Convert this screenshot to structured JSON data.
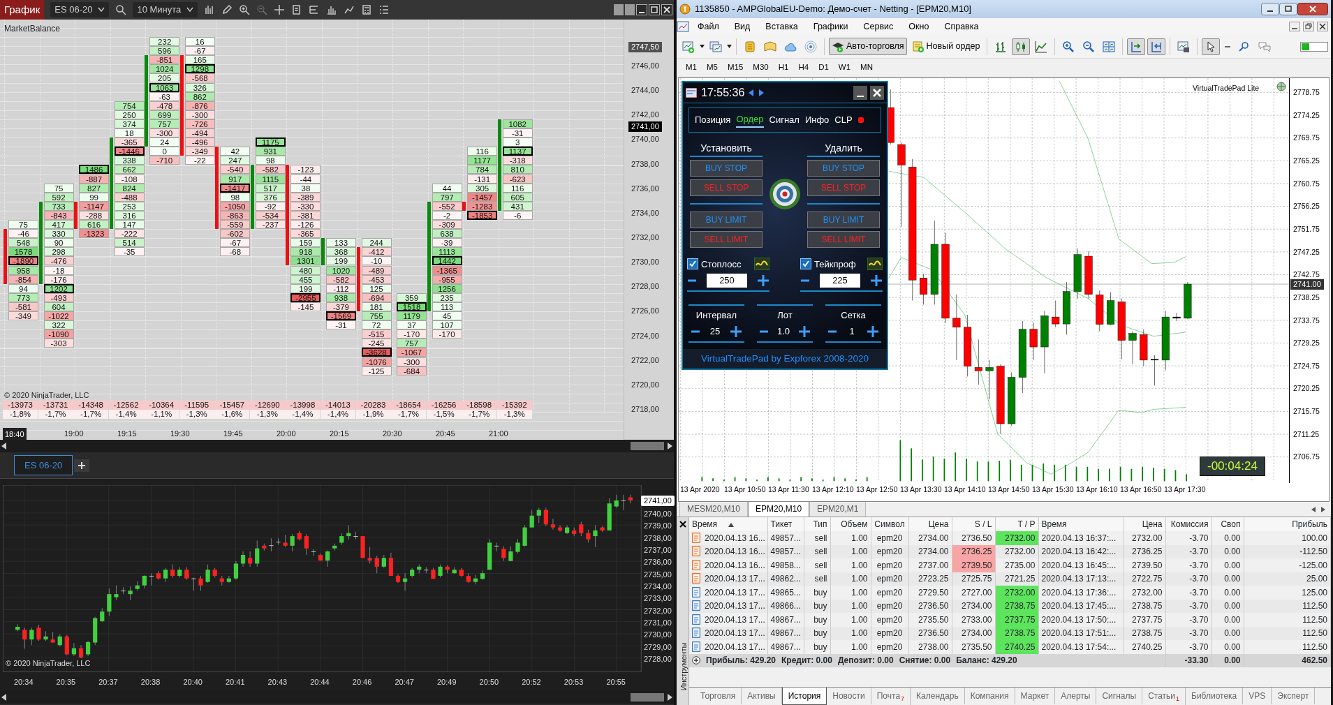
{
  "ninja": {
    "toolbar": {
      "title": "График",
      "instrument": "ES 06-20",
      "interval": "10 Минута"
    },
    "footprint": {
      "indicator": "MarketBalance",
      "copyright": "© 2020 NinjaTrader, LLC",
      "columns": [
        {
          "kind": "down",
          "total": "-13973",
          "percent": "-1,8%",
          "cells": [
            {
              "value": "75",
              "boxed": false
            },
            {
              "value": "-46",
              "boxed": false
            },
            {
              "value": "548",
              "boxed": false
            },
            {
              "value": "1578",
              "boxed": false
            },
            {
              "value": "-1890",
              "boxed": true
            },
            {
              "value": "958",
              "boxed": false
            },
            {
              "value": "-854",
              "boxed": false
            },
            {
              "value": "94",
              "boxed": false
            },
            {
              "value": "773",
              "boxed": false
            },
            {
              "value": "-581",
              "boxed": false
            },
            {
              "value": "-349",
              "boxed": false
            }
          ]
        },
        {
          "kind": "up",
          "total": "-13731",
          "percent": "-1,7%",
          "cells": [
            {
              "value": "75",
              "boxed": false
            },
            {
              "value": "592",
              "boxed": false
            },
            {
              "value": "733",
              "boxed": false
            },
            {
              "value": "-843",
              "boxed": false
            },
            {
              "value": "417",
              "boxed": false
            },
            {
              "value": "330",
              "boxed": false
            },
            {
              "value": "90",
              "boxed": false
            },
            {
              "value": "298",
              "boxed": false
            },
            {
              "value": "-476",
              "boxed": false
            },
            {
              "value": "-18",
              "boxed": false
            },
            {
              "value": "-176",
              "boxed": false
            },
            {
              "value": "1202",
              "boxed": true
            },
            {
              "value": "-493",
              "boxed": false
            },
            {
              "value": "604",
              "boxed": false
            },
            {
              "value": "-1022",
              "boxed": false
            },
            {
              "value": "322",
              "boxed": false
            },
            {
              "value": "-1090",
              "boxed": false
            },
            {
              "value": "-303",
              "boxed": false
            }
          ]
        },
        {
          "kind": "down",
          "total": "-14348",
          "percent": "-1,7%",
          "cells": [
            {
              "value": "1486",
              "boxed": true
            },
            {
              "value": "-887",
              "boxed": false
            },
            {
              "value": "827",
              "boxed": false
            },
            {
              "value": "99",
              "boxed": false
            },
            {
              "value": "-1147",
              "boxed": false
            },
            {
              "value": "-288",
              "boxed": false
            },
            {
              "value": "616",
              "boxed": false
            },
            {
              "value": "-1323",
              "boxed": false
            }
          ]
        },
        {
          "kind": "up",
          "total": "-12562",
          "percent": "-1,4%",
          "cells": [
            {
              "value": "754",
              "boxed": false
            },
            {
              "value": "250",
              "boxed": false
            },
            {
              "value": "374",
              "boxed": false
            },
            {
              "value": "18",
              "boxed": false
            },
            {
              "value": "-365",
              "boxed": false
            },
            {
              "value": "-1446",
              "boxed": true
            },
            {
              "value": "338",
              "boxed": false
            },
            {
              "value": "662",
              "boxed": false
            },
            {
              "value": "-108",
              "boxed": false
            },
            {
              "value": "824",
              "boxed": false
            },
            {
              "value": "-488",
              "boxed": false
            },
            {
              "value": "253",
              "boxed": false
            },
            {
              "value": "316",
              "boxed": false
            },
            {
              "value": "147",
              "boxed": false
            },
            {
              "value": "-222",
              "boxed": false
            },
            {
              "value": "514",
              "boxed": false
            },
            {
              "value": "-35",
              "boxed": false
            }
          ]
        },
        {
          "kind": "up",
          "total": "-10364",
          "percent": "-1,1%",
          "cells": [
            {
              "value": "232",
              "boxed": false
            },
            {
              "value": "596",
              "boxed": false
            },
            {
              "value": "-851",
              "boxed": false
            },
            {
              "value": "1024",
              "boxed": false
            },
            {
              "value": "205",
              "boxed": false
            },
            {
              "value": "1063",
              "boxed": true
            },
            {
              "value": "-63",
              "boxed": false
            },
            {
              "value": "-478",
              "boxed": false
            },
            {
              "value": "699",
              "boxed": false
            },
            {
              "value": "757",
              "boxed": false
            },
            {
              "value": "-300",
              "boxed": false
            },
            {
              "value": "24",
              "boxed": false
            },
            {
              "value": "0",
              "boxed": false
            },
            {
              "value": "-710",
              "boxed": false
            }
          ]
        },
        {
          "kind": "down",
          "total": "-11595",
          "percent": "-1,3%",
          "cells": [
            {
              "value": "16",
              "boxed": false
            },
            {
              "value": "-67",
              "boxed": false
            },
            {
              "value": "165",
              "boxed": false
            },
            {
              "value": "1298",
              "boxed": true
            },
            {
              "value": "-568",
              "boxed": false
            },
            {
              "value": "326",
              "boxed": false
            },
            {
              "value": "862",
              "boxed": false
            },
            {
              "value": "-876",
              "boxed": false
            },
            {
              "value": "-300",
              "boxed": false
            },
            {
              "value": "-726",
              "boxed": false
            },
            {
              "value": "-494",
              "boxed": false
            },
            {
              "value": "-496",
              "boxed": false
            },
            {
              "value": "-349",
              "boxed": false
            },
            {
              "value": "-22",
              "boxed": false
            }
          ]
        },
        {
          "kind": "down",
          "total": "-15457",
          "percent": "-1,6%",
          "cells": [
            {
              "value": "42",
              "boxed": false
            },
            {
              "value": "247",
              "boxed": false
            },
            {
              "value": "-540",
              "boxed": false
            },
            {
              "value": "917",
              "boxed": false
            },
            {
              "value": "-1417",
              "boxed": true
            },
            {
              "value": "98",
              "boxed": false
            },
            {
              "value": "-1050",
              "boxed": false
            },
            {
              "value": "-863",
              "boxed": false
            },
            {
              "value": "-559",
              "boxed": false
            },
            {
              "value": "-602",
              "boxed": false
            },
            {
              "value": "-67",
              "boxed": false
            },
            {
              "value": "-68",
              "boxed": false
            }
          ]
        },
        {
          "kind": "up",
          "total": "-12690",
          "percent": "-1,3%",
          "cells": [
            {
              "value": "1175",
              "boxed": true
            },
            {
              "value": "931",
              "boxed": false
            },
            {
              "value": "98",
              "boxed": false
            },
            {
              "value": "-582",
              "boxed": false
            },
            {
              "value": "1115",
              "boxed": false
            },
            {
              "value": "517",
              "boxed": false
            },
            {
              "value": "376",
              "boxed": false
            },
            {
              "value": "-92",
              "boxed": false
            },
            {
              "value": "-534",
              "boxed": false
            },
            {
              "value": "-237",
              "boxed": false
            }
          ]
        },
        {
          "kind": "down",
          "total": "-13998",
          "percent": "-1,4%",
          "cells": [
            {
              "value": "-123",
              "boxed": false
            },
            {
              "value": "-44",
              "boxed": false
            },
            {
              "value": "38",
              "boxed": false
            },
            {
              "value": "-389",
              "boxed": false
            },
            {
              "value": "-330",
              "boxed": false
            },
            {
              "value": "-381",
              "boxed": false
            },
            {
              "value": "-126",
              "boxed": false
            },
            {
              "value": "-365",
              "boxed": false
            },
            {
              "value": "159",
              "boxed": false
            },
            {
              "value": "918",
              "boxed": false
            },
            {
              "value": "1301",
              "boxed": false
            },
            {
              "value": "480",
              "boxed": false
            },
            {
              "value": "455",
              "boxed": false
            },
            {
              "value": "199",
              "boxed": false
            },
            {
              "value": "-2955",
              "boxed": true
            },
            {
              "value": "-145",
              "boxed": false
            }
          ]
        },
        {
          "kind": "up",
          "total": "-14013",
          "percent": "-1,4%",
          "cells": [
            {
              "value": "133",
              "boxed": false
            },
            {
              "value": "368",
              "boxed": false
            },
            {
              "value": "199",
              "boxed": false
            },
            {
              "value": "1020",
              "boxed": false
            },
            {
              "value": "-582",
              "boxed": false
            },
            {
              "value": "-112",
              "boxed": false
            },
            {
              "value": "938",
              "boxed": false
            },
            {
              "value": "-379",
              "boxed": false
            },
            {
              "value": "-1569",
              "boxed": true
            },
            {
              "value": "-31",
              "boxed": false
            }
          ]
        },
        {
          "kind": "down",
          "total": "-20283",
          "percent": "-1,9%",
          "cells": [
            {
              "value": "244",
              "boxed": false
            },
            {
              "value": "-412",
              "boxed": false
            },
            {
              "value": "-10",
              "boxed": false
            },
            {
              "value": "-489",
              "boxed": false
            },
            {
              "value": "-453",
              "boxed": false
            },
            {
              "value": "125",
              "boxed": false
            },
            {
              "value": "-694",
              "boxed": false
            },
            {
              "value": "181",
              "boxed": false
            },
            {
              "value": "755",
              "boxed": false
            },
            {
              "value": "72",
              "boxed": false
            },
            {
              "value": "-515",
              "boxed": false
            },
            {
              "value": "-245",
              "boxed": false
            },
            {
              "value": "-3628",
              "boxed": true
            },
            {
              "value": "-1076",
              "boxed": false
            },
            {
              "value": "-125",
              "boxed": false
            }
          ]
        },
        {
          "kind": "flat",
          "total": "-18654",
          "percent": "-1,7%",
          "cells": [
            {
              "value": "359",
              "boxed": false
            },
            {
              "value": "1518",
              "boxed": true
            },
            {
              "value": "1179",
              "boxed": false
            },
            {
              "value": "37",
              "boxed": false
            },
            {
              "value": "-170",
              "boxed": false
            },
            {
              "value": "757",
              "boxed": false
            },
            {
              "value": "-1067",
              "boxed": false
            },
            {
              "value": "-300",
              "boxed": false
            },
            {
              "value": "-684",
              "boxed": false
            }
          ]
        },
        {
          "kind": "up",
          "total": "-16256",
          "percent": "-1,5%",
          "cells": [
            {
              "value": "44",
              "boxed": false
            },
            {
              "value": "797",
              "boxed": false
            },
            {
              "value": "-552",
              "boxed": false
            },
            {
              "value": "-2",
              "boxed": false
            },
            {
              "value": "-309",
              "boxed": false
            },
            {
              "value": "638",
              "boxed": false
            },
            {
              "value": "-39",
              "boxed": false
            },
            {
              "value": "1113",
              "boxed": false
            },
            {
              "value": "1442",
              "boxed": true
            },
            {
              "value": "-1365",
              "boxed": false
            },
            {
              "value": "-955",
              "boxed": false
            },
            {
              "value": "1256",
              "boxed": false
            },
            {
              "value": "235",
              "boxed": false
            },
            {
              "value": "113",
              "boxed": false
            },
            {
              "value": "45",
              "boxed": false
            },
            {
              "value": "107",
              "boxed": false
            },
            {
              "value": "-170",
              "boxed": false
            }
          ]
        },
        {
          "kind": "down",
          "total": "-18598",
          "percent": "-1,7%",
          "cells": [
            {
              "value": "116",
              "boxed": false
            },
            {
              "value": "1177",
              "boxed": false
            },
            {
              "value": "784",
              "boxed": false
            },
            {
              "value": "-131",
              "boxed": false
            },
            {
              "value": "305",
              "boxed": false
            },
            {
              "value": "-1457",
              "boxed": false
            },
            {
              "value": "-1283",
              "boxed": false
            },
            {
              "value": "-1853",
              "boxed": true
            }
          ]
        },
        {
          "kind": "up",
          "total": "-15392",
          "percent": "-1,3%",
          "cells": [
            {
              "value": "1082",
              "boxed": false
            },
            {
              "value": "-31",
              "boxed": false
            },
            {
              "value": "3",
              "boxed": false
            },
            {
              "value": "1137",
              "boxed": true
            },
            {
              "value": "-318",
              "boxed": false
            },
            {
              "value": "810",
              "boxed": false
            },
            {
              "value": "-623",
              "boxed": false
            },
            {
              "value": "116",
              "boxed": false
            },
            {
              "value": "605",
              "boxed": false
            },
            {
              "value": "431",
              "boxed": false
            },
            {
              "value": "-6",
              "boxed": false
            }
          ]
        }
      ],
      "price_labels": [
        "2746,00",
        "2744,00",
        "2742,00",
        "2740,00",
        "2738,00",
        "2736,00",
        "2734,00",
        "2732,00",
        "2730,00",
        "2728,00",
        "2726,00",
        "2724,00",
        "2722,00",
        "2720,00",
        "2718,00"
      ],
      "price_markers": [
        {
          "text": "2747,50",
          "kind": "ask"
        },
        {
          "text": "2741,00",
          "kind": "last"
        }
      ],
      "time_labels": [
        {
          "text": "18:40",
          "selected": true
        },
        {
          "text": "19:00",
          "selected": false
        },
        {
          "text": "19:15",
          "selected": false
        },
        {
          "text": "19:30",
          "selected": false
        },
        {
          "text": "19:45",
          "selected": false
        },
        {
          "text": "20:00",
          "selected": false
        },
        {
          "text": "20:15",
          "selected": false
        },
        {
          "text": "20:30",
          "selected": false
        },
        {
          "text": "20:45",
          "selected": false
        },
        {
          "text": "21:00",
          "selected": false
        }
      ]
    },
    "tabs": [
      {
        "label": "ES 06-20",
        "selected": true
      }
    ],
    "candle_chart": {
      "copyright": "© 2020 NinjaTrader, LLC",
      "price_marker": "2741,00",
      "price_labels": [
        "2740,00",
        "2739,00",
        "2738,00",
        "2737,00",
        "2736,00",
        "2735,00",
        "2734,00",
        "2733,00",
        "2732,00",
        "2731,00",
        "2730,00",
        "2729,00",
        "2728,00"
      ],
      "time_labels": [
        "20:34",
        "20:35",
        "20:37",
        "20:38",
        "20:40",
        "20:41",
        "20:43",
        "20:44",
        "20:46",
        "20:47",
        "20:49",
        "20:50",
        "20:52",
        "20:53",
        "20:55"
      ]
    }
  },
  "mt4": {
    "title": "1135850 - AMPGlobalEU-Demo: Демо-счет - Netting - [EPM20,M10]",
    "menu": [
      "Файл",
      "Вид",
      "Вставка",
      "Графики",
      "Сервис",
      "Окно",
      "Справка"
    ],
    "toolbar": [
      {
        "kind": "new-chart",
        "pressed": false
      },
      {
        "kind": "profiles",
        "pressed": false
      },
      {
        "kind": "market-watch",
        "pressed": false
      },
      {
        "kind": "navigator",
        "pressed": false
      },
      {
        "kind": "cloud",
        "pressed": false
      },
      {
        "kind": "signals",
        "pressed": false
      },
      {
        "kind": "auto-trading",
        "label": "Авто-торговля",
        "pressed": true
      },
      {
        "kind": "new-order",
        "label": "Новый ордер",
        "pressed": false
      },
      {
        "kind": "bar-chart",
        "pressed": false
      },
      {
        "kind": "candles",
        "pressed": true
      },
      {
        "kind": "line-chart",
        "pressed": false
      },
      {
        "kind": "zoom-in",
        "pressed": false
      },
      {
        "kind": "zoom-out",
        "pressed": false
      },
      {
        "kind": "tile",
        "pressed": false
      },
      {
        "kind": "autoscroll",
        "pressed": true
      },
      {
        "kind": "chart-shift",
        "pressed": true
      },
      {
        "kind": "templates",
        "pressed": false
      },
      {
        "kind": "cursor",
        "pressed": true
      },
      {
        "kind": "crosshair",
        "pressed": false
      },
      {
        "kind": "zoom",
        "pressed": false
      },
      {
        "kind": "chat",
        "pressed": false
      }
    ],
    "timeframes": [
      "M1",
      "M5",
      "M15",
      "M30",
      "H1",
      "H4",
      "D1",
      "W1",
      "MN"
    ],
    "chart": {
      "pad_label": "VirtualTradePad  Lite",
      "price_marker": "2741.00",
      "timer": "-00:04:24",
      "price_labels": [
        "2778.75",
        "2774.25",
        "2769.75",
        "2765.25",
        "2760.75",
        "2756.25",
        "2751.75",
        "2747.25",
        "2742.75",
        "2738.25",
        "2733.75",
        "2729.25",
        "2724.75",
        "2720.25",
        "2715.75",
        "2711.25",
        "2706.75"
      ],
      "date_labels": [
        "13 Apr 2020",
        "13 Apr 10:50",
        "13 Apr 11:30",
        "13 Apr 12:10",
        "13 Apr 12:50",
        "13 Apr 13:30",
        "13 Apr 14:10",
        "13 Apr 14:50",
        "13 Apr 15:30",
        "13 Apr 16:10",
        "13 Apr 16:50",
        "13 Apr 17:30"
      ]
    },
    "trade_pad": {
      "time": "17:55:36",
      "tabs": [
        {
          "label": "Позиция",
          "selected": false
        },
        {
          "label": "Ордер",
          "selected": true
        },
        {
          "label": "Сигнал",
          "selected": false
        },
        {
          "label": "Инфо",
          "selected": false
        },
        {
          "label": "CLP",
          "selected": false
        }
      ],
      "set_heading": "Установить",
      "delete_heading": "Удалить",
      "set_buttons": [
        {
          "label": "BUY STOP",
          "kind": "buy"
        },
        {
          "label": "SELL STOP",
          "kind": "sell"
        },
        {
          "label": "BUY LIMIT",
          "kind": "buy"
        },
        {
          "label": "SELL LIMIT",
          "kind": "sell"
        }
      ],
      "delete_buttons": [
        {
          "label": "BUY STOP",
          "kind": "buy"
        },
        {
          "label": "SELL STOP",
          "kind": "sell"
        },
        {
          "label": "BUY LIMIT",
          "kind": "buy"
        },
        {
          "label": "SELL LIMIT",
          "kind": "sell"
        }
      ],
      "stop_loss": {
        "label": "Стоплосс",
        "checked": true,
        "value": "250"
      },
      "take_profit": {
        "label": "Тейкпроф",
        "checked": true,
        "value": "225"
      },
      "steppers": [
        {
          "label": "Интервал",
          "value": "25"
        },
        {
          "label": "Лот",
          "value": "1.0"
        },
        {
          "label": "Сетка",
          "value": "1"
        }
      ],
      "footer": "VirtualTradePad by Expforex 2008-2020"
    },
    "chart_tabs": [
      {
        "label": "MESM20,M10",
        "selected": false
      },
      {
        "label": "EPM20,M10",
        "selected": true
      },
      {
        "label": "EPM20,M1",
        "selected": false
      }
    ],
    "terminal": {
      "side_label": "Инструменты",
      "columns": [
        "Время",
        "Тикет",
        "Тип",
        "Объем",
        "Символ",
        "Цена",
        "S / L",
        "T / P",
        "Время",
        "Цена",
        "Комиссия",
        "Своп",
        "Прибыль"
      ],
      "rows": [
        {
          "kind": "sell",
          "sl_hit": false,
          "tp_hit": true,
          "cells": [
            "2020.04.13 16...",
            "49857...",
            "sell",
            "1.00",
            "epm20",
            "2734.00",
            "2736.50",
            "2732.00",
            "2020.04.13 16:37:...",
            "2732.00",
            "-3.70",
            "0.00",
            "100.00"
          ]
        },
        {
          "kind": "sell",
          "sl_hit": true,
          "tp_hit": false,
          "cells": [
            "2020.04.13 16...",
            "49857...",
            "sell",
            "1.00",
            "epm20",
            "2734.00",
            "2736.25",
            "2732.00",
            "2020.04.13 16:42:...",
            "2736.25",
            "-3.70",
            "0.00",
            "-112.50"
          ]
        },
        {
          "kind": "sell",
          "sl_hit": true,
          "tp_hit": false,
          "cells": [
            "2020.04.13 16...",
            "49858...",
            "sell",
            "1.00",
            "epm20",
            "2737.00",
            "2739.50",
            "2735.00",
            "2020.04.13 16:45:...",
            "2739.50",
            "-3.70",
            "0.00",
            "-125.00"
          ]
        },
        {
          "kind": "sell",
          "sl_hit": false,
          "tp_hit": false,
          "cells": [
            "2020.04.13 17...",
            "49862...",
            "sell",
            "1.00",
            "epm20",
            "2723.25",
            "2725.75",
            "2721.25",
            "2020.04.13 17:13:...",
            "2722.75",
            "-3.70",
            "0.00",
            "25.00"
          ]
        },
        {
          "kind": "buy",
          "sl_hit": false,
          "tp_hit": true,
          "cells": [
            "2020.04.13 17...",
            "49865...",
            "buy",
            "1.00",
            "epm20",
            "2729.50",
            "2727.00",
            "2732.00",
            "2020.04.13 17:36:...",
            "2732.00",
            "-3.70",
            "0.00",
            "125.00"
          ]
        },
        {
          "kind": "buy",
          "sl_hit": false,
          "tp_hit": true,
          "cells": [
            "2020.04.13 17...",
            "49866...",
            "buy",
            "1.00",
            "epm20",
            "2736.50",
            "2734.00",
            "2738.75",
            "2020.04.13 17:45:...",
            "2738.75",
            "-3.70",
            "0.00",
            "112.50"
          ]
        },
        {
          "kind": "buy",
          "sl_hit": false,
          "tp_hit": true,
          "cells": [
            "2020.04.13 17...",
            "49867...",
            "buy",
            "1.00",
            "epm20",
            "2735.50",
            "2733.00",
            "2737.75",
            "2020.04.13 17:50:...",
            "2737.75",
            "-3.70",
            "0.00",
            "112.50"
          ]
        },
        {
          "kind": "buy",
          "sl_hit": false,
          "tp_hit": true,
          "cells": [
            "2020.04.13 17...",
            "49867...",
            "buy",
            "1.00",
            "epm20",
            "2736.50",
            "2734.00",
            "2738.75",
            "2020.04.13 17:51:...",
            "2738.75",
            "-3.70",
            "0.00",
            "112.50"
          ]
        },
        {
          "kind": "buy",
          "sl_hit": false,
          "tp_hit": true,
          "cells": [
            "2020.04.13 17...",
            "49867...",
            "buy",
            "1.00",
            "epm20",
            "2738.00",
            "2735.50",
            "2740.25",
            "2020.04.13 17:54:...",
            "2740.25",
            "-3.70",
            "0.00",
            "112.50"
          ]
        }
      ],
      "summary": {
        "items": [
          "Прибыль: 429.20",
          "Кредит: 0.00",
          "Депозит: 0.00",
          "Снятие: 0.00",
          "Баланс: 429.20"
        ],
        "commission": "-33.30",
        "swap": "0.00",
        "profit": "462.50"
      },
      "tabs": [
        {
          "label": "Торговля",
          "selected": false
        },
        {
          "label": "Активы",
          "selected": false
        },
        {
          "label": "История",
          "selected": true
        },
        {
          "label": "Новости",
          "selected": false
        },
        {
          "label": "Почта",
          "badge": "7",
          "selected": false
        },
        {
          "label": "Календарь",
          "selected": false
        },
        {
          "label": "Компания",
          "selected": false
        },
        {
          "label": "Маркет",
          "selected": false
        },
        {
          "label": "Алерты",
          "selected": false
        },
        {
          "label": "Сигналы",
          "selected": false
        },
        {
          "label": "Статьи",
          "badge": "1",
          "selected": false
        },
        {
          "label": "Библиотека",
          "selected": false
        },
        {
          "label": "VPS",
          "selected": false
        },
        {
          "label": "Эксперт",
          "selected": false
        }
      ]
    }
  }
}
